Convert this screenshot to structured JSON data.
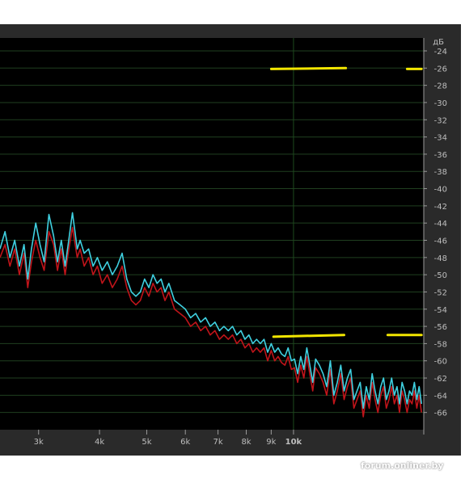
{
  "chart_data": {
    "type": "line",
    "xscale": "log",
    "xlim": [
      2500,
      18500
    ],
    "ylim": [
      -68,
      -22.5
    ],
    "unit_label": "дБ",
    "x_ticks": [
      {
        "value": 3000,
        "label": "3k"
      },
      {
        "value": 4000,
        "label": "4k"
      },
      {
        "value": 5000,
        "label": "5k"
      },
      {
        "value": 6000,
        "label": "6k"
      },
      {
        "value": 7000,
        "label": "7k"
      },
      {
        "value": 8000,
        "label": "8k"
      },
      {
        "value": 9000,
        "label": "9k"
      },
      {
        "value": 10000,
        "label": "10k"
      }
    ],
    "y_ticks": [
      {
        "value": -24,
        "label": "-24"
      },
      {
        "value": -26,
        "label": "-26"
      },
      {
        "value": -28,
        "label": "-28"
      },
      {
        "value": -30,
        "label": "-30"
      },
      {
        "value": -32,
        "label": "-32"
      },
      {
        "value": -34,
        "label": "-34"
      },
      {
        "value": -36,
        "label": "-36"
      },
      {
        "value": -38,
        "label": "-38"
      },
      {
        "value": -40,
        "label": "-40"
      },
      {
        "value": -42,
        "label": "-42"
      },
      {
        "value": -44,
        "label": "-44"
      },
      {
        "value": -46,
        "label": "-46"
      },
      {
        "value": -48,
        "label": "-48"
      },
      {
        "value": -50,
        "label": "-50"
      },
      {
        "value": -52,
        "label": "-52"
      },
      {
        "value": -54,
        "label": "-54"
      },
      {
        "value": -56,
        "label": "-56"
      },
      {
        "value": -58,
        "label": "-58"
      },
      {
        "value": -60,
        "label": "-60"
      },
      {
        "value": -62,
        "label": "-62"
      },
      {
        "value": -64,
        "label": "-64"
      },
      {
        "value": -66,
        "label": "-66"
      }
    ],
    "grid": true,
    "background": "#000000",
    "series": [
      {
        "color": "#c0141a",
        "x": [
          2500,
          2560,
          2620,
          2680,
          2740,
          2800,
          2850,
          2900,
          2960,
          3020,
          3080,
          3150,
          3220,
          3280,
          3340,
          3400,
          3450,
          3520,
          3600,
          3650,
          3720,
          3800,
          3880,
          3960,
          4050,
          4150,
          4250,
          4350,
          4450,
          4550,
          4650,
          4750,
          4850,
          4950,
          5050,
          5150,
          5250,
          5350,
          5450,
          5550,
          5700,
          5850,
          6000,
          6150,
          6300,
          6450,
          6600,
          6750,
          6900,
          7050,
          7200,
          7350,
          7500,
          7650,
          7800,
          7950,
          8100,
          8250,
          8400,
          8550,
          8700,
          8850,
          9000,
          9150,
          9300,
          9450,
          9600,
          9750,
          9900,
          10050,
          10200,
          10350,
          10500,
          10650,
          10800,
          10950,
          11100,
          11300,
          11500,
          11700,
          11900,
          12100,
          12300,
          12500,
          12700,
          12900,
          13100,
          13300,
          13500,
          13700,
          13900,
          14100,
          14300,
          14500,
          14700,
          14900,
          15100,
          15300,
          15500,
          15700,
          15900,
          16100,
          16300,
          16500,
          16700,
          16900,
          17100,
          17300,
          17500,
          17700,
          17900,
          18100,
          18300
        ],
        "y": [
          -48,
          -46.5,
          -49,
          -47,
          -50,
          -47.5,
          -51.5,
          -48.5,
          -46,
          -48,
          -49.5,
          -45,
          -46.5,
          -49.5,
          -47,
          -50,
          -47.5,
          -44.5,
          -48,
          -47,
          -49,
          -48,
          -50,
          -49,
          -51,
          -50,
          -51.5,
          -50.5,
          -49,
          -51.5,
          -53,
          -53.5,
          -53,
          -51.5,
          -52.5,
          -51,
          -52,
          -51.5,
          -53,
          -52,
          -54,
          -54.5,
          -55,
          -56,
          -55.5,
          -56.5,
          -56,
          -57,
          -56.5,
          -57.5,
          -57,
          -57.5,
          -57,
          -58,
          -57.5,
          -58.5,
          -58,
          -59,
          -58.5,
          -59,
          -58.5,
          -60,
          -58.8,
          -60,
          -59.5,
          -60.2,
          -60.5,
          -59.5,
          -61,
          -60.8,
          -62.5,
          -60.5,
          -62,
          -59.5,
          -61.5,
          -63.5,
          -60.8,
          -61.5,
          -62.5,
          -64,
          -61,
          -65,
          -63.5,
          -61.5,
          -64.5,
          -63,
          -62,
          -65.5,
          -64.5,
          -63.5,
          -66.5,
          -64,
          -65.5,
          -62.5,
          -64.5,
          -66,
          -64,
          -63,
          -65.5,
          -64.5,
          -63,
          -65,
          -64,
          -66,
          -63.5,
          -64.5,
          -66,
          -64.5,
          -65,
          -63.5,
          -65.5,
          -64,
          -66
        ]
      },
      {
        "color": "#3fd0e0",
        "x": [
          2500,
          2560,
          2620,
          2680,
          2740,
          2800,
          2850,
          2900,
          2960,
          3020,
          3080,
          3150,
          3220,
          3280,
          3340,
          3400,
          3450,
          3520,
          3600,
          3650,
          3720,
          3800,
          3880,
          3960,
          4050,
          4150,
          4250,
          4350,
          4450,
          4550,
          4650,
          4750,
          4850,
          4950,
          5050,
          5150,
          5250,
          5350,
          5450,
          5550,
          5700,
          5850,
          6000,
          6150,
          6300,
          6450,
          6600,
          6750,
          6900,
          7050,
          7200,
          7350,
          7500,
          7650,
          7800,
          7950,
          8100,
          8250,
          8400,
          8550,
          8700,
          8850,
          9000,
          9150,
          9300,
          9450,
          9600,
          9750,
          9900,
          10050,
          10200,
          10350,
          10500,
          10650,
          10800,
          10950,
          11100,
          11300,
          11500,
          11700,
          11900,
          12100,
          12300,
          12500,
          12700,
          12900,
          13100,
          13300,
          13500,
          13700,
          13900,
          14100,
          14300,
          14500,
          14700,
          14900,
          15100,
          15300,
          15500,
          15700,
          15900,
          16100,
          16300,
          16500,
          16700,
          16900,
          17100,
          17300,
          17500,
          17700,
          17900,
          18100,
          18300
        ],
        "y": [
          -47,
          -45,
          -48,
          -46,
          -49,
          -46.5,
          -50.5,
          -47,
          -44,
          -46.5,
          -48.5,
          -43,
          -45.5,
          -48.5,
          -46,
          -49,
          -46.5,
          -42.8,
          -47,
          -46,
          -47.5,
          -47,
          -49,
          -48,
          -49.5,
          -48.5,
          -50,
          -49,
          -47.5,
          -50.5,
          -52,
          -52.5,
          -52,
          -50.5,
          -51.5,
          -50,
          -51,
          -50.5,
          -52,
          -51,
          -53,
          -53.5,
          -54,
          -55,
          -54.5,
          -55.5,
          -55,
          -56,
          -55.5,
          -56.5,
          -56,
          -56.5,
          -56,
          -57,
          -56.5,
          -57.5,
          -57,
          -58,
          -57.5,
          -58,
          -57.5,
          -59,
          -58,
          -59,
          -58.5,
          -59.2,
          -59.5,
          -58.5,
          -60,
          -59.8,
          -61.5,
          -59.5,
          -61,
          -58.5,
          -60.5,
          -62.5,
          -59.8,
          -60.5,
          -61.5,
          -63,
          -60,
          -64,
          -62.5,
          -60.5,
          -63.5,
          -62,
          -61,
          -64.5,
          -63.5,
          -62.5,
          -65.5,
          -63,
          -64.5,
          -61.5,
          -63.5,
          -65,
          -63,
          -62,
          -64.5,
          -63.5,
          -62,
          -64,
          -63,
          -65,
          -62.5,
          -63.5,
          -65,
          -63.5,
          -64,
          -62.5,
          -64.5,
          -63,
          -65
        ]
      }
    ],
    "annotations": [
      {
        "color": "#f2e600",
        "x": [
          9000,
          12800
        ],
        "y": [
          -26.1,
          -26.0
        ]
      },
      {
        "color": "#f2e600",
        "x": [
          17100,
          18300
        ],
        "y": [
          -26.1,
          -26.1
        ]
      },
      {
        "color": "#f2e600",
        "x": [
          9100,
          12700
        ],
        "y": [
          -57.2,
          -57.0
        ]
      },
      {
        "color": "#f2e600",
        "x": [
          15600,
          18300
        ],
        "y": [
          -57.0,
          -57.0
        ]
      }
    ],
    "markers": [
      {
        "x": 10000,
        "color": "#1d4a1d"
      }
    ]
  },
  "watermark": "forum.onliner.by"
}
